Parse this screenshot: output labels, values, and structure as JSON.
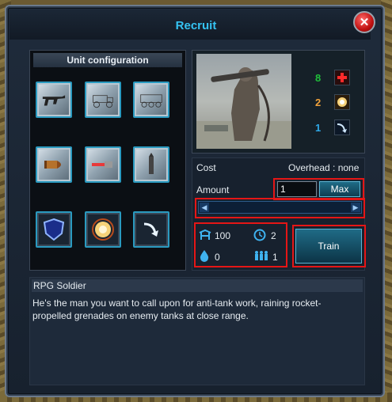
{
  "window": {
    "title": "Recruit",
    "close_icon": "close-icon"
  },
  "unit_config": {
    "header": "Unit configuration",
    "slots": [
      {
        "icon": "assault-rifle-icon"
      },
      {
        "icon": "truck-icon"
      },
      {
        "icon": "armored-vehicle-icon"
      },
      {
        "icon": "bullet-icon"
      },
      {
        "icon": "laser-bullet-icon"
      },
      {
        "icon": "sniper-bullet-icon"
      },
      {
        "icon": "shield-icon"
      },
      {
        "icon": "explosion-icon"
      },
      {
        "icon": "speed-arrow-icon"
      }
    ]
  },
  "unit_stats": [
    {
      "value": "8",
      "icon": "health-cross-icon",
      "color": "#1fbf3a"
    },
    {
      "value": "2",
      "icon": "explosion-icon",
      "color": "#f0a13a"
    },
    {
      "value": "1",
      "icon": "speed-arrow-icon",
      "color": "#2fa9e8"
    }
  ],
  "cost": {
    "label": "Cost",
    "overhead_label": "Overhead : none",
    "amount_label": "Amount",
    "amount_value": "1",
    "max_button": "Max",
    "resources": [
      {
        "icon": "supply-icon",
        "value": "100"
      },
      {
        "icon": "clock-icon",
        "value": "2"
      },
      {
        "icon": "water-drop-icon",
        "value": "0"
      },
      {
        "icon": "population-icon",
        "value": "1"
      }
    ],
    "train_button": "Train"
  },
  "description": {
    "title": "RPG Soldier",
    "text": "He's the man you want to call upon for anti-tank work, raining rocket-propelled grenades on enemy tanks at close range."
  },
  "colors": {
    "accent": "#35c3f2",
    "highlight": "#e51616"
  }
}
